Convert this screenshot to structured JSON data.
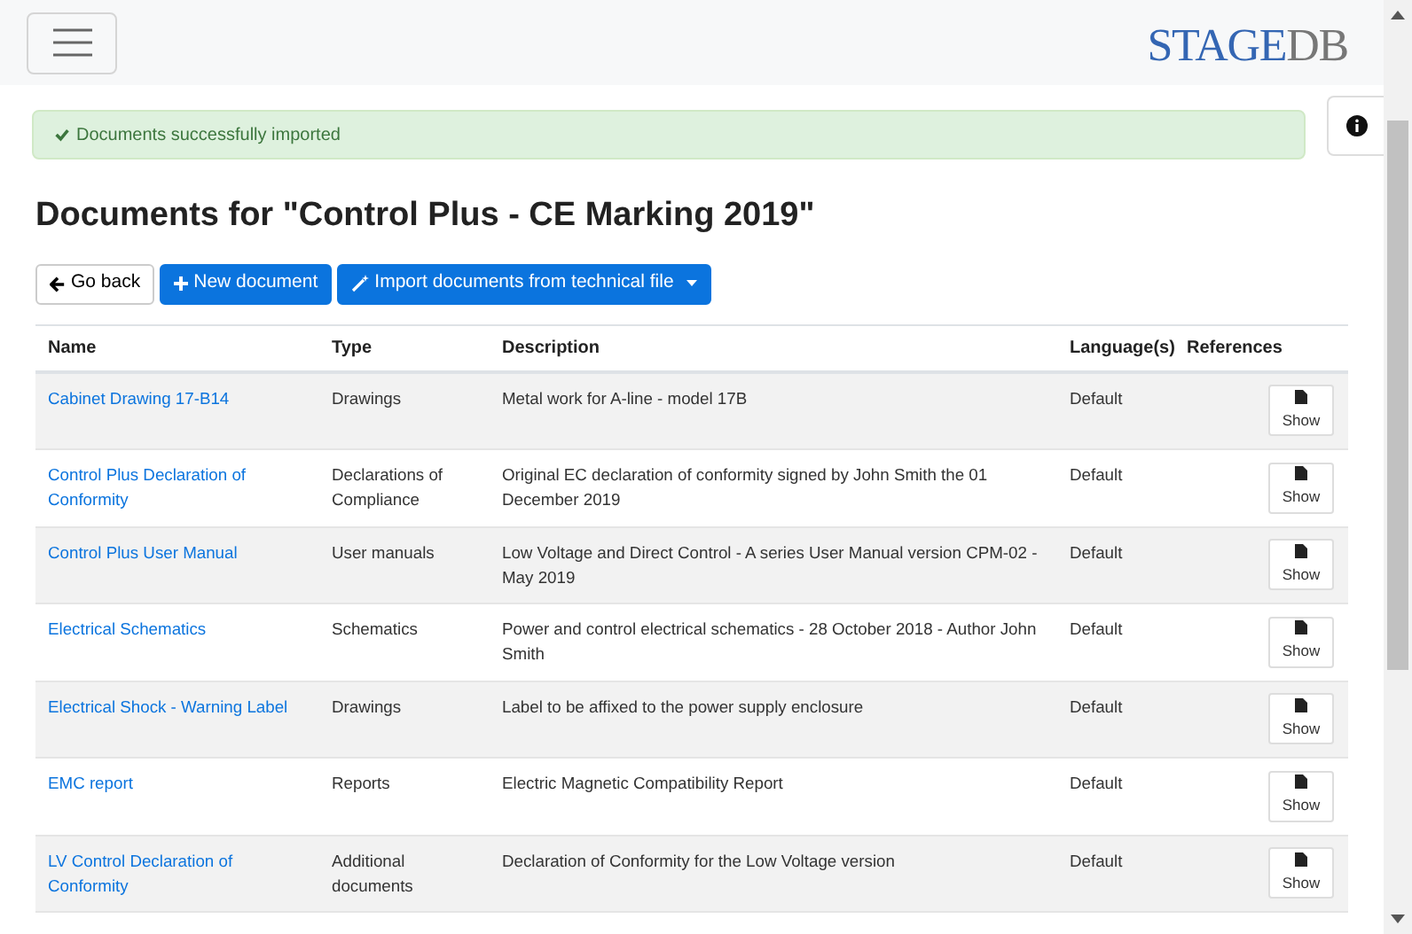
{
  "header": {
    "logo": {
      "primary": "STAGE",
      "secondary": "DB"
    }
  },
  "alert": {
    "message": "Documents successfully imported"
  },
  "title": "Documents for \"Control Plus - CE Marking 2019\"",
  "toolbar": [
    {
      "kind": "back",
      "label": "Go back"
    },
    {
      "kind": "new",
      "label": "New document"
    },
    {
      "kind": "import",
      "label": "Import documents from technical file"
    }
  ],
  "table": {
    "columns": [
      "Name",
      "Type",
      "Description",
      "Language(s)",
      "References"
    ],
    "rows": [
      {
        "name": "Cabinet Drawing 17-B14",
        "type": "Drawings",
        "description": "Metal work for A-line - model 17B",
        "language": "Default",
        "action": "Show"
      },
      {
        "name": "Control Plus Declaration of Conformity",
        "type": "Declarations of Compliance",
        "description": "Original EC declaration of conformity signed by John Smith the 01 December 2019",
        "language": "Default",
        "action": "Show"
      },
      {
        "name": "Control Plus User Manual",
        "type": "User manuals",
        "description": "Low Voltage and Direct Control - A series User Manual version CPM-02 - May 2019",
        "language": "Default",
        "action": "Show"
      },
      {
        "name": "Electrical Schematics",
        "type": "Schematics",
        "description": "Power and control electrical schematics - 28 October 2018 - Author John Smith",
        "language": "Default",
        "action": "Show"
      },
      {
        "name": "Electrical Shock - Warning Label",
        "type": "Drawings",
        "description": "Label to be affixed to the power supply enclosure",
        "language": "Default",
        "action": "Show"
      },
      {
        "name": "EMC report",
        "type": "Reports",
        "description": "Electric Magnetic Compatibility Report",
        "language": "Default",
        "action": "Show"
      },
      {
        "name": "LV Control Declaration of Conformity",
        "type": "Additional documents",
        "description": "Declaration of Conformity for the Low Voltage version",
        "language": "Default",
        "action": "Show"
      }
    ]
  }
}
